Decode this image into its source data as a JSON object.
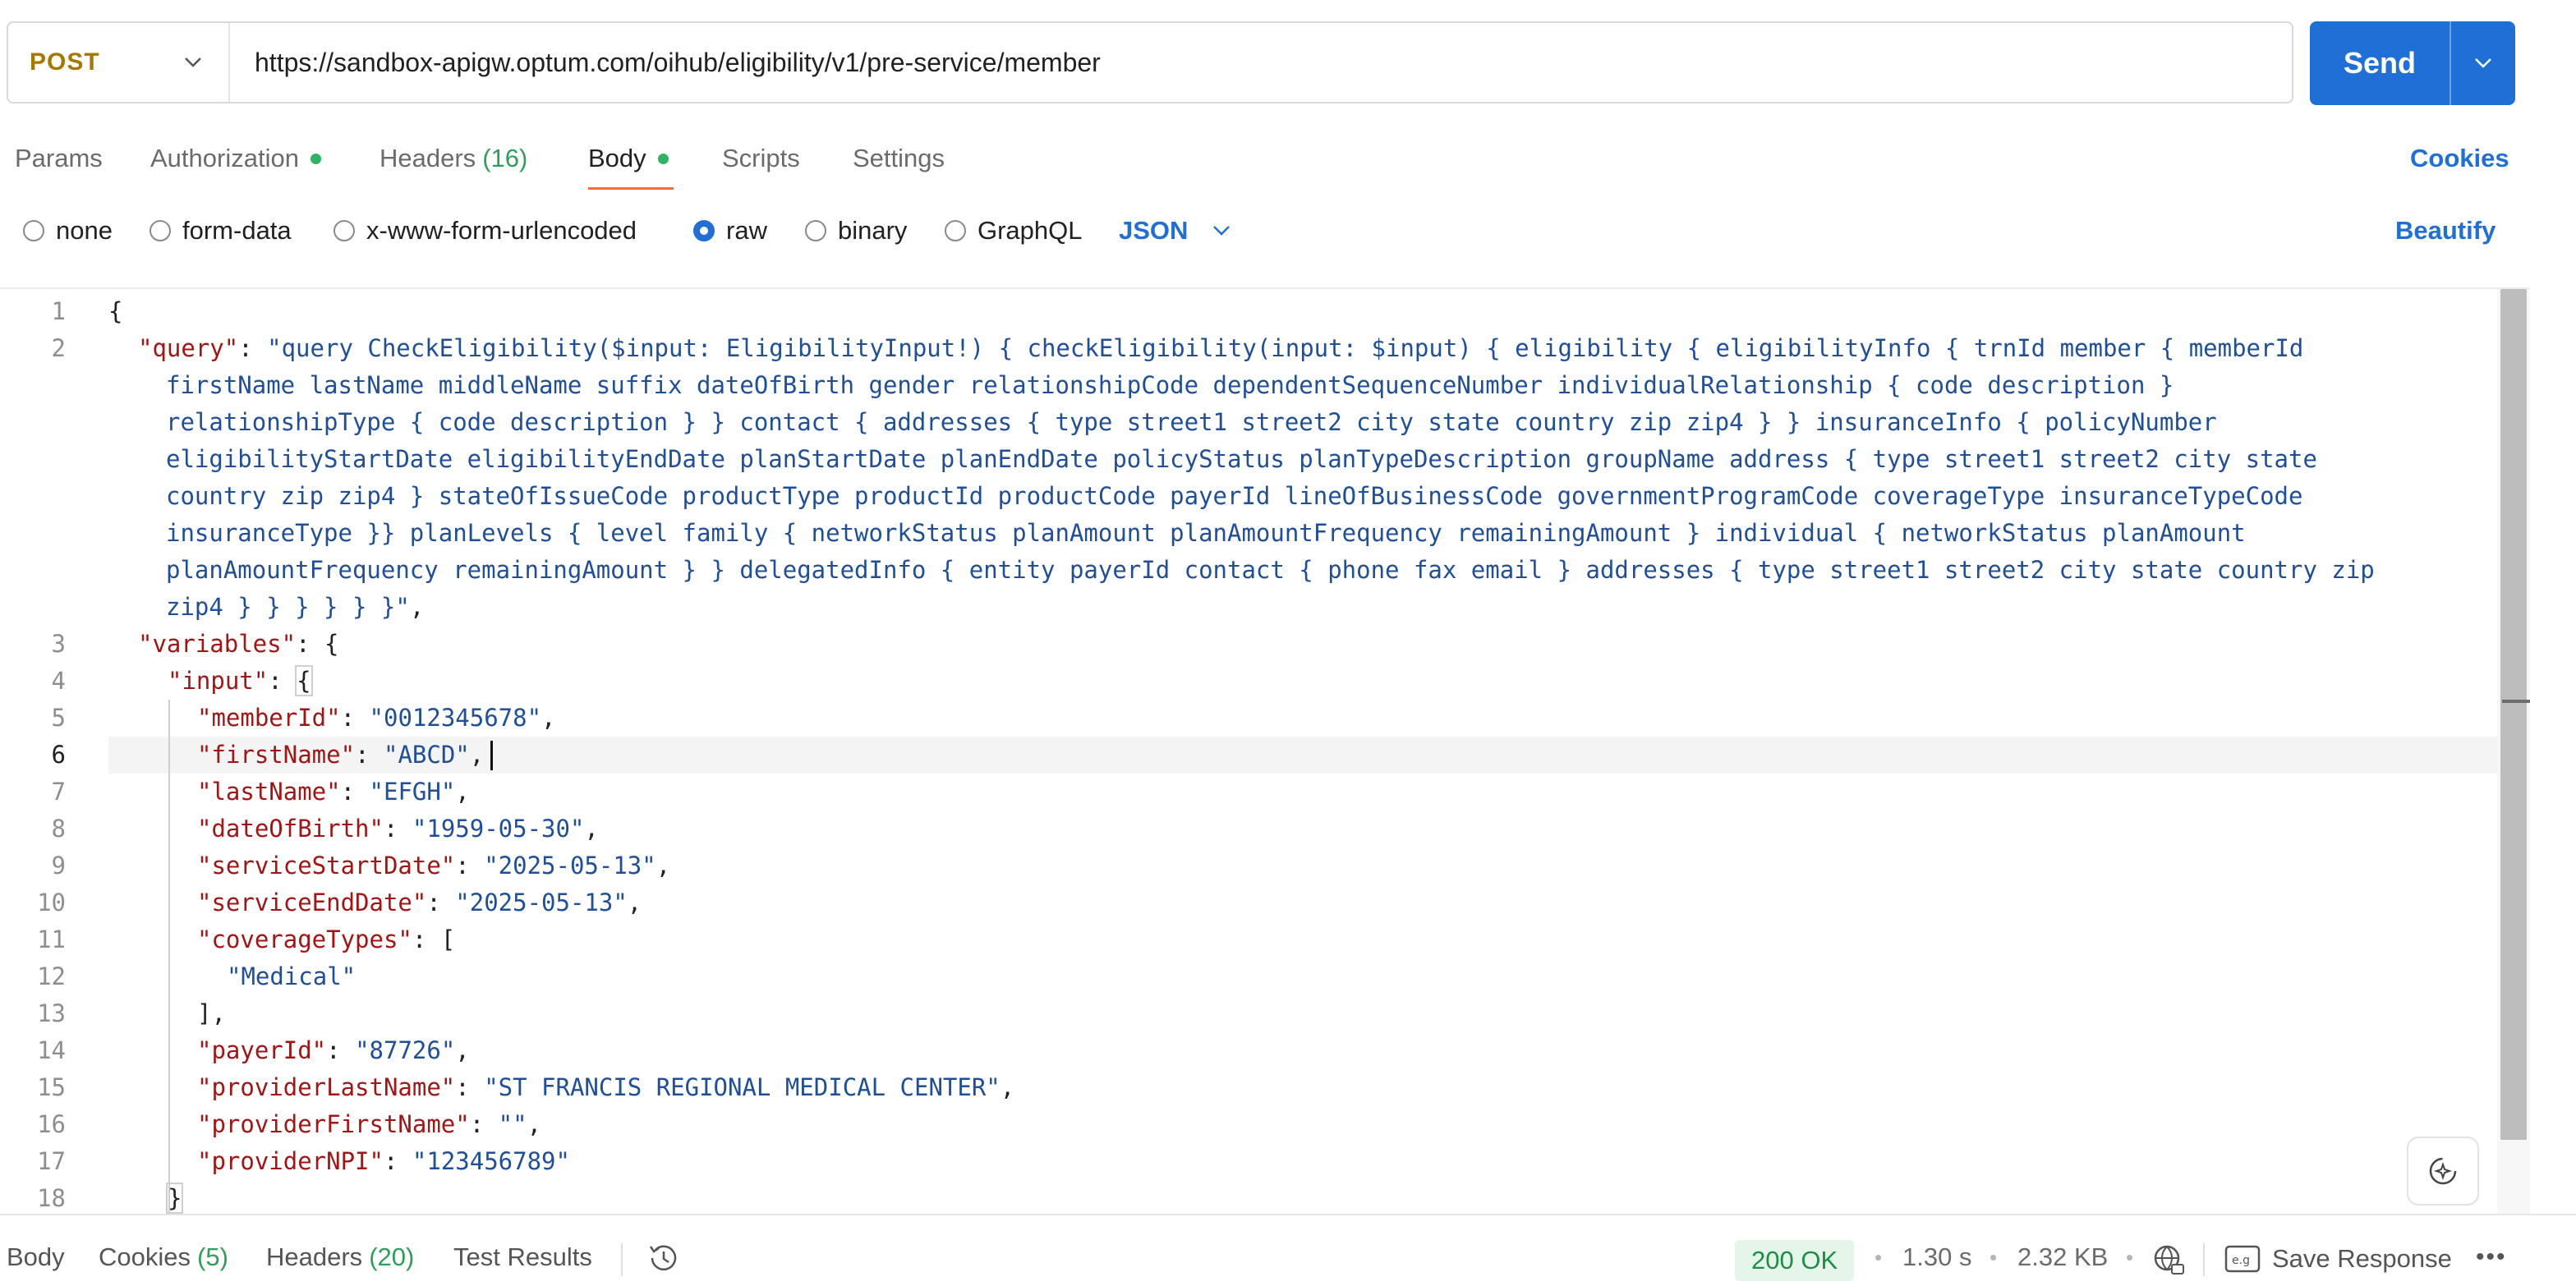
{
  "request": {
    "method": "POST",
    "url": "https://sandbox-apigw.optum.com/oihub/eligibility/v1/pre-service/member",
    "send_label": "Send"
  },
  "tabs": [
    {
      "label": "Params",
      "count": "",
      "dot": false
    },
    {
      "label": "Authorization",
      "count": "",
      "dot": true
    },
    {
      "label": "Headers",
      "count": "(16)",
      "dot": false
    },
    {
      "label": "Body",
      "count": "",
      "dot": true,
      "active": true
    },
    {
      "label": "Scripts",
      "count": "",
      "dot": false
    },
    {
      "label": "Settings",
      "count": "",
      "dot": false
    }
  ],
  "cookies_label": "Cookies",
  "body_types": [
    {
      "label": "none",
      "selected": false
    },
    {
      "label": "form-data",
      "selected": false
    },
    {
      "label": "x-www-form-urlencoded",
      "selected": false
    },
    {
      "label": "raw",
      "selected": true
    },
    {
      "label": "binary",
      "selected": false
    },
    {
      "label": "GraphQL",
      "selected": false
    }
  ],
  "format_select": "JSON",
  "beautify_label": "Beautify",
  "editor": {
    "line_numbers": [
      "1",
      "2",
      "3",
      "4",
      "5",
      "6",
      "7",
      "8",
      "9",
      "10",
      "11",
      "12",
      "13",
      "14",
      "15",
      "16",
      "17",
      "18"
    ],
    "current_line": "6",
    "line1": "{",
    "query_key": "\"query\"",
    "query_lines": [
      "\"query CheckEligibility($input: EligibilityInput!) { checkEligibility(input: $input) { eligibility { eligibilityInfo { trnId member { memberId",
      "firstName lastName middleName suffix dateOfBirth gender relationshipCode dependentSequenceNumber individualRelationship { code description }",
      "relationshipType { code description } } contact { addresses { type street1 street2 city state country zip zip4 } } insuranceInfo { policyNumber",
      "eligibilityStartDate eligibilityEndDate planStartDate planEndDate policyStatus planTypeDescription groupName address { type street1 street2 city state",
      "country zip zip4 } stateOfIssueCode productType productId productCode payerId lineOfBusinessCode governmentProgramCode coverageType insuranceTypeCode",
      "insuranceType }} planLevels { level family { networkStatus planAmount planAmountFrequency remainingAmount } individual { networkStatus planAmount",
      "planAmountFrequency remainingAmount } } delegatedInfo { entity payerId contact { phone fax email } addresses { type street1 street2 city state country zip",
      "zip4 } } } } } }\""
    ],
    "variables_key": "\"variables\"",
    "input_key": "\"input\"",
    "fields": [
      {
        "key": "\"memberId\"",
        "value": "\"0012345678\"",
        "comma": ","
      },
      {
        "key": "\"firstName\"",
        "value": "\"ABCD\"",
        "comma": ","
      },
      {
        "key": "\"lastName\"",
        "value": "\"EFGH\"",
        "comma": ","
      },
      {
        "key": "\"dateOfBirth\"",
        "value": "\"1959-05-30\"",
        "comma": ","
      },
      {
        "key": "\"serviceStartDate\"",
        "value": "\"2025-05-13\"",
        "comma": ","
      },
      {
        "key": "\"serviceEndDate\"",
        "value": "\"2025-05-13\"",
        "comma": ","
      }
    ],
    "coverage_key": "\"coverageTypes\"",
    "coverage_value": "\"Medical\"",
    "fields2": [
      {
        "key": "\"payerId\"",
        "value": "\"87726\"",
        "comma": ","
      },
      {
        "key": "\"providerLastName\"",
        "value": "\"ST FRANCIS REGIONAL MEDICAL CENTER\"",
        "comma": ","
      },
      {
        "key": "\"providerFirstName\"",
        "value": "\"\"",
        "comma": ","
      },
      {
        "key": "\"providerNPI\"",
        "value": "\"123456789\"",
        "comma": ""
      }
    ]
  },
  "response_bar": {
    "tabs": [
      {
        "label": "Body",
        "count": ""
      },
      {
        "label": "Cookies",
        "count": "(5)"
      },
      {
        "label": "Headers",
        "count": "(20)"
      },
      {
        "label": "Test Results",
        "count": ""
      }
    ],
    "status": "200 OK",
    "time": "1.30 s",
    "size": "2.32 KB",
    "save_label": "Save Response"
  }
}
